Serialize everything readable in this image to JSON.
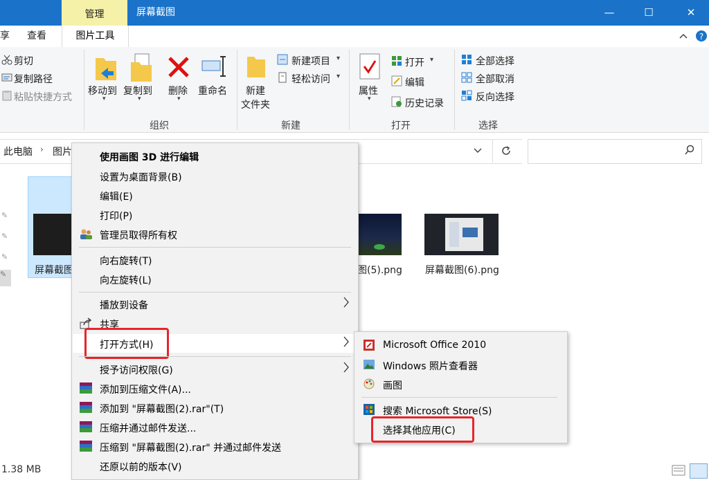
{
  "titlebar": {
    "manage_tab": "管理",
    "title": "屏幕截图",
    "minimize": "—",
    "maximize": "☐",
    "close": "✕"
  },
  "ribbon_tabs": {
    "partial": "享",
    "view": "查看",
    "picture_tools": "图片工具",
    "help_arrow": "^",
    "help": "?"
  },
  "ribbon": {
    "clipboard": {
      "cut": "剪切",
      "copy_path": "复制路径",
      "paste_shortcut": "粘贴快捷方式"
    },
    "organize": {
      "move_to": "移动到",
      "copy_to": "复制到",
      "delete": "删除",
      "rename": "重命名",
      "label": "组织"
    },
    "new": {
      "new_folder_line1": "新建",
      "new_folder_line2": "文件夹",
      "new_item": "新建项目",
      "easy_access": "轻松访问",
      "label": "新建"
    },
    "open": {
      "properties": "属性",
      "open": "打开",
      "edit": "编辑",
      "history": "历史记录",
      "label": "打开"
    },
    "select": {
      "select_all": "全部选择",
      "select_none": "全部取消",
      "invert": "反向选择",
      "label": "选择"
    }
  },
  "address": {
    "crumb1": "此电脑",
    "crumb2": "图片"
  },
  "files": {
    "file1": "屏幕截图",
    "file5": "图(5).png",
    "file6": "屏幕截图(6).png"
  },
  "status": {
    "size": "1.38 MB"
  },
  "context_menu": {
    "edit_paint3d": "使用画图 3D 进行编辑",
    "set_wallpaper": "设置为桌面背景(B)",
    "edit": "编辑(E)",
    "print": "打印(P)",
    "take_ownership": "管理员取得所有权",
    "rotate_right": "向右旋转(T)",
    "rotate_left": "向左旋转(L)",
    "cast": "播放到设备",
    "share": "共享",
    "open_with": "打开方式(H)",
    "grant_access": "授予访问权限(G)",
    "add_archive": "添加到压缩文件(A)...",
    "add_rar": "添加到 \"屏幕截图(2).rar\"(T)",
    "compress_email": "压缩并通过邮件发送...",
    "compress_rar_email": "压缩到 \"屏幕截图(2).rar\" 并通过邮件发送",
    "restore_previous": "还原以前的版本(V)"
  },
  "submenu": {
    "office": "Microsoft Office 2010",
    "photo_viewer": "Windows 照片查看器",
    "paint": "画图",
    "store": "搜索 Microsoft Store(S)",
    "choose_other": "选择其他应用(C)"
  },
  "colors": {
    "titlebar": "#1a73c9",
    "manage_tab": "#f6f1a8",
    "highlight": "#e8242a",
    "menu_bg": "#f2f2f2"
  }
}
